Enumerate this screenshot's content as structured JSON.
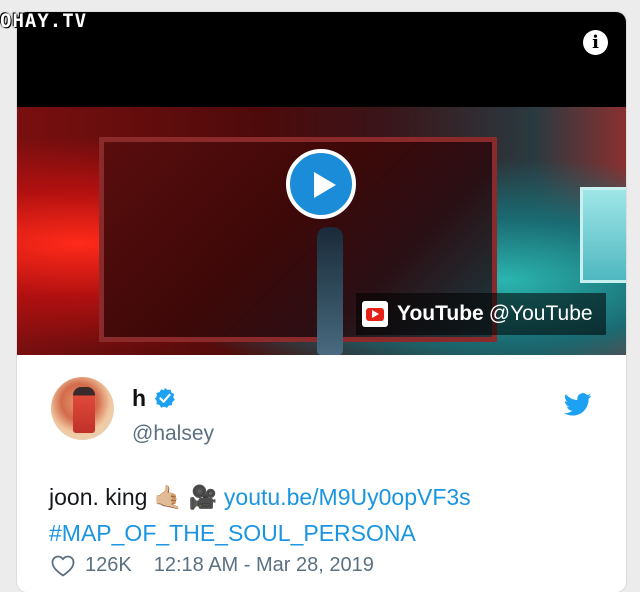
{
  "watermark": "OHAY.TV",
  "video": {
    "info_icon": "info-icon",
    "play_icon": "play-icon",
    "youtube_brand": "YouTube",
    "youtube_handle": "@YouTube"
  },
  "tweet": {
    "display_name": "h",
    "handle": "@halsey",
    "text_prefix": "joon. king",
    "emoji_1": "🤙🏼",
    "emoji_2": "🎥",
    "link": "youtu.be/M9Uy0opVF3s",
    "hashtag": "#MAP_OF_THE_SOUL_PERSONA",
    "likes": "126K",
    "timestamp": "12:18 AM - Mar 28, 2019"
  },
  "colors": {
    "link": "#1b95e0",
    "twitter_blue": "#1da1f2",
    "play_blue": "#1a8cd8",
    "youtube_red": "#e62117"
  }
}
